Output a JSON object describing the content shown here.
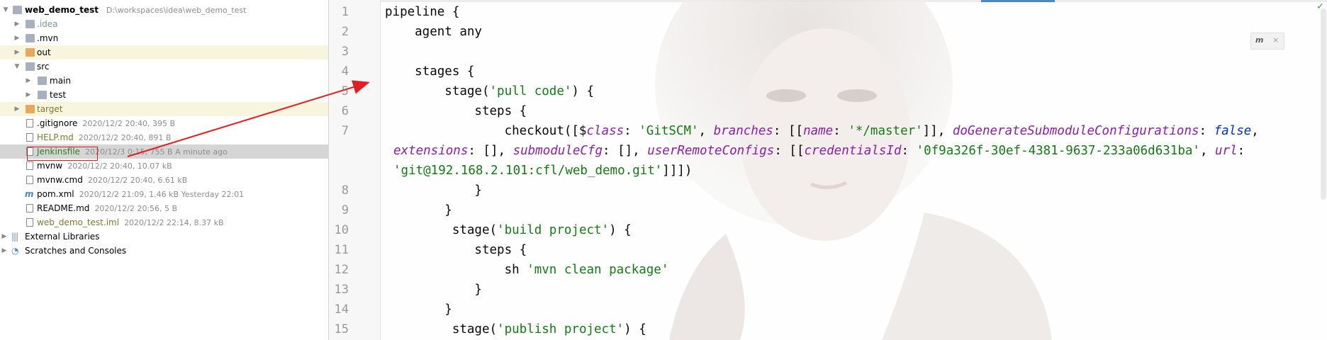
{
  "project": {
    "root": {
      "name": "web_demo_test",
      "path": "D:\\workspaces\\idea\\web_demo_test"
    },
    "items": [
      {
        "name": ".idea",
        "meta": ""
      },
      {
        "name": ".mvn",
        "meta": ""
      },
      {
        "name": "out",
        "meta": ""
      },
      {
        "name": "src",
        "meta": ""
      },
      {
        "name": "main",
        "meta": ""
      },
      {
        "name": "test",
        "meta": ""
      },
      {
        "name": "target",
        "meta": ""
      },
      {
        "name": ".gitignore",
        "meta": "2020/12/2 20:40, 395 B"
      },
      {
        "name": "HELP.md",
        "meta": "2020/12/2 20:40, 891 B"
      },
      {
        "name": "Jenkinsfile",
        "meta": "2020/12/3 0:15, 755 B A minute ago"
      },
      {
        "name": "mvnw",
        "meta": "2020/12/2 20:40, 10.07 kB"
      },
      {
        "name": "mvnw.cmd",
        "meta": "2020/12/2 20:40, 6.61 kB"
      },
      {
        "name": "pom.xml",
        "meta": "2020/12/2 21:09, 1.46 kB Yesterday 22:01"
      },
      {
        "name": "README.md",
        "meta": "2020/12/2 20:56, 5 B"
      },
      {
        "name": "web_demo_test.iml",
        "meta": "2020/12/2 22:14, 8.37 kB"
      }
    ],
    "external_libraries": "External Libraries",
    "scratches": "Scratches and Consoles"
  },
  "editor": {
    "line_numbers": [
      "1",
      "2",
      "3",
      "4",
      "5",
      "6",
      "7",
      "8",
      "9",
      "10",
      "11",
      "12",
      "13",
      "14",
      "15"
    ],
    "code": {
      "l1": "pipeline {",
      "l2": "    agent any",
      "l4": "    stages {",
      "l5_a": "        stage(",
      "l5_s": "'pull code'",
      "l5_b": ") {",
      "l6": "            steps {",
      "l7_a": "                checkout([$",
      "l7_k1": "class",
      "l7_b": ": ",
      "l7_s1": "'GitSCM'",
      "l7_c": ", ",
      "l7_k2": "branches",
      "l7_d": ": [[",
      "l7_k3": "name",
      "l7_e": ": ",
      "l7_s2": "'*/master'",
      "l7_f": "]], ",
      "l7_k4": "doGenerateSubmoduleConfigurations",
      "l7_g": ": ",
      "l7_kw": "false",
      "l7_h": ",",
      "l7w_k1": "extensions",
      "l7w_a": ": [], ",
      "l7w_k2": "submoduleCfg",
      "l7w_b": ": [], ",
      "l7w_k3": "userRemoteConfigs",
      "l7w_c": ": [[",
      "l7w_k4": "credentialsId",
      "l7w_d": ": ",
      "l7w_s1": "'0f9a326f-30ef-4381-9637-233a06d631ba'",
      "l7w_e": ", ",
      "l7w_k5": "url",
      "l7w_f": ":",
      "l7w2_s": "'git@192.168.2.101:cfl/web_demo.git'",
      "l7w2_a": "]]])",
      "l8": "            }",
      "l9": "        }",
      "l10_a": "         stage(",
      "l10_s": "'build project'",
      "l10_b": ") {",
      "l11": "            steps {",
      "l12_a": "                sh ",
      "l12_s": "'mvn clean package'",
      "l13": "            }",
      "l14": "        }",
      "l15_a": "         stage(",
      "l15_s": "'publish project'",
      "l15_b": ") {"
    }
  },
  "colors": {
    "annotation": "#e02020",
    "string": "#127c12",
    "key": "#8b1fa6",
    "keyword": "#0033b3"
  }
}
